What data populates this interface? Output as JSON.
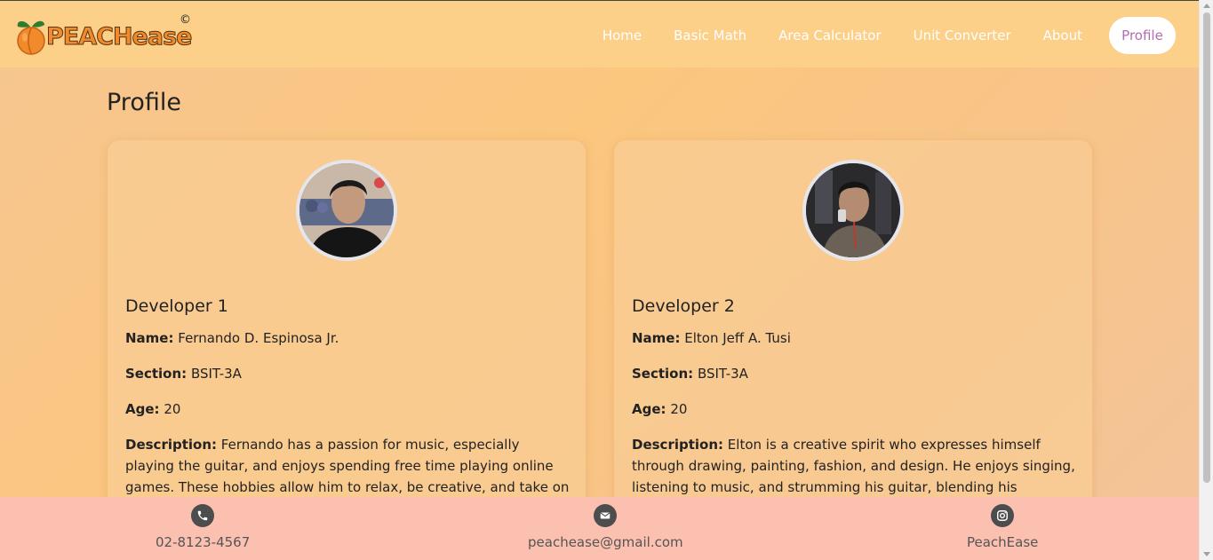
{
  "navbar": {
    "logo_text": "PEACHease",
    "logo_mark": "©",
    "links": [
      "Home",
      "Basic Math",
      "Area Calculator",
      "Unit Converter",
      "About"
    ],
    "active": "Profile"
  },
  "page": {
    "title": "Profile"
  },
  "developers": [
    {
      "heading": "Developer 1",
      "name_label": "Name:",
      "name": "Fernando D. Espinosa Jr.",
      "section_label": "Section:",
      "section": "BSIT-3A",
      "age_label": "Age:",
      "age": "20",
      "description_label": "Description:",
      "description": "Fernando has a passion for music, especially playing the guitar, and enjoys spending free time playing online games. These hobbies allow him to relax, be creative, and take on new challenges in"
    },
    {
      "heading": "Developer 2",
      "name_label": "Name:",
      "name": "Elton Jeff A. Tusi",
      "section_label": "Section:",
      "section": "BSIT-3A",
      "age_label": "Age:",
      "age": "20",
      "description_label": "Description:",
      "description": "Elton is a creative spirit who expresses himself through drawing, painting, fashion, and design. He enjoys singing, listening to music, and strumming his guitar, blending his passions into a vibrant"
    }
  ],
  "footer": {
    "phone": "02-8123-4567",
    "email": "peachease@gmail.com",
    "instagram": "PeachEase",
    "icons": [
      "phone-icon",
      "mail-icon",
      "instagram-icon"
    ]
  },
  "colors": {
    "navbar_bg": "#fcd089",
    "footer_bg": "#fbc0b0",
    "active_link_text": "#b66bb0",
    "logo_orange": "#f08a2a"
  }
}
